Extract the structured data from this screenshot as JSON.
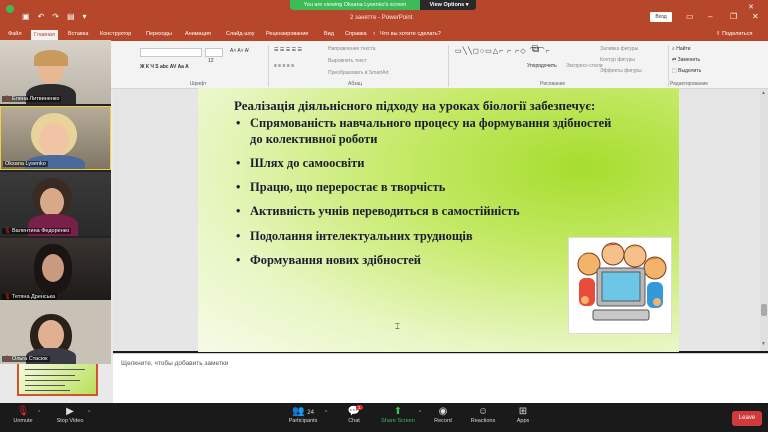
{
  "zoom": {
    "banner_text": "You are viewing Oksana Lysenko's screen",
    "view_options": "View Options ▾",
    "toolbar": {
      "unmute": "Unmute",
      "stop_video": "Stop Video",
      "participants": "Participants",
      "participants_count": "24",
      "chat": "Chat",
      "chat_badge": "1",
      "share_screen": "Share Screen",
      "record": "Record",
      "reactions": "Reactions",
      "apps": "Apps",
      "leave": "Leave"
    },
    "participants": [
      {
        "name": "Елена Литвиненко"
      },
      {
        "name": "Oksana Lysenko"
      },
      {
        "name": "Валентина Федоренко"
      },
      {
        "name": "Тетяна Дренська"
      },
      {
        "name": "Ольга Стасюк"
      }
    ],
    "accent_green": "#3dbb58",
    "leave_red": "#d13a3a"
  },
  "powerpoint": {
    "document_title": "2 занятте - PowerPoint",
    "signin_label": "Вход",
    "share_label": "Поделиться",
    "tabs": [
      "Файл",
      "Главная",
      "Вставка",
      "Конструктор",
      "Переходы",
      "Анимация",
      "Слайд-шоу",
      "Рецензирование",
      "Вид",
      "Справка",
      "Что вы хотите сделать?"
    ],
    "ribbon": {
      "groups": [
        "Шрифт",
        "Абзац",
        "Рисование",
        "Редактирование"
      ],
      "font_size": "12",
      "paragraph_items": [
        "Направление текста",
        "Выровнять текст",
        "Преобразовать в SmartArt"
      ],
      "drawing_items": [
        "Упорядочить",
        "Экспресс-стили",
        "Заливка фигуры",
        "Контур фигуры",
        "Эффекты фигуры"
      ],
      "editing_items": [
        "Найти",
        "Заменить",
        "Выделить"
      ]
    },
    "notes_placeholder": "Щелкните, чтобы добавить заметки",
    "brand_color": "#b7472a"
  },
  "slide": {
    "title": "Реалізація діяльнісного підходу на уроках біології забезпечує:",
    "bullets": [
      "Спрямованість навчального процесу на формування здібностей",
      "до колективної роботи",
      "Шлях до самоосвіти",
      "Працю, що переростає в творчість",
      "Активність  учнів переводиться  в самостійність",
      "Подолання інтелектуальних  труднощів",
      "Формування нових здібностей"
    ],
    "bullet_marker": "•"
  }
}
